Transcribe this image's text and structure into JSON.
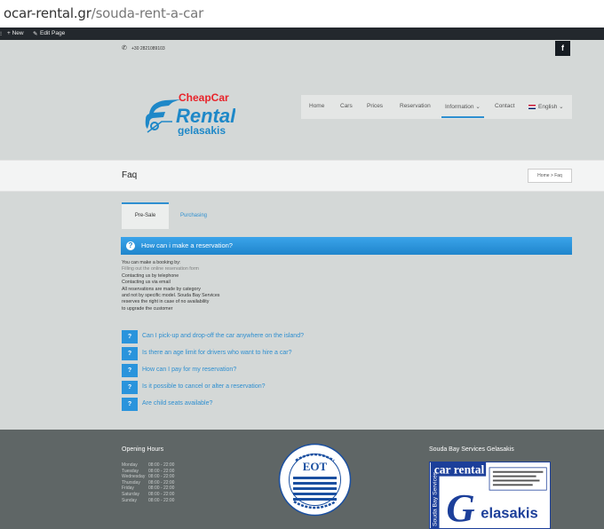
{
  "browser": {
    "url_host": "ocar-rental.gr",
    "url_path": "/souda-rent-a-car"
  },
  "admin_bar": {
    "new_label": "+ New",
    "edit_label": "Edit Page"
  },
  "topbar": {
    "phone": "+30 2821089103",
    "facebook_label": "f"
  },
  "logo": {
    "line1": "CheapCar",
    "line2": "Rental",
    "line3": "gelasakis"
  },
  "nav": {
    "items": [
      "Home",
      "Cars",
      "Prices",
      "Reservation",
      "Information ⌄",
      "Contact",
      "English ⌄"
    ]
  },
  "page": {
    "title": "Faq",
    "breadcrumb": "Home > Faq"
  },
  "tabs": [
    "Pre-Sale",
    "Purchasing"
  ],
  "faq_open": {
    "question": "How can i make a reservation?",
    "answer_lines": [
      "You can make a booking by:",
      "Filling out the online reservation form",
      "Contacting us by telephone",
      "Contacting us via email",
      "All reservations are made by category",
      "and not by specific model. Souda Bay Services",
      "reserves the right in case of no availability",
      "to upgrade the customer"
    ]
  },
  "faq_items": [
    "Can I pick-up and drop-off the car anywhere on the island?",
    "Is there an age limit for drivers who want to hire a car?",
    "How can I pay for my reservation?",
    "Is it possible to cancel or alter a reservation?",
    "Are child seats available?"
  ],
  "footer": {
    "hours_title": "Opening Hours",
    "hours": [
      {
        "day": "Monday",
        "time": "08:00 - 22:00"
      },
      {
        "day": "Tuesday",
        "time": "08:00 - 22:00"
      },
      {
        "day": "Wednesday",
        "time": "08:00 - 22:00"
      },
      {
        "day": "Thursday",
        "time": "08:00 - 22:00"
      },
      {
        "day": "Friday",
        "time": "08:00 - 22:00"
      },
      {
        "day": "Saturday",
        "time": "08:00 - 22:00"
      },
      {
        "day": "Sunday",
        "time": "08:00 - 22:00"
      }
    ],
    "eot_text": "EOT",
    "company_title": "Souda Bay Services Gelasakis",
    "banner_title": "car rental",
    "banner_brand": "elasakis",
    "banner_side": "Souda Bay Services"
  },
  "colors": {
    "accent": "#2e8fd0",
    "logo_red": "#e8232a",
    "logo_blue": "#1e88c8",
    "footer_bg": "#5f6666"
  }
}
